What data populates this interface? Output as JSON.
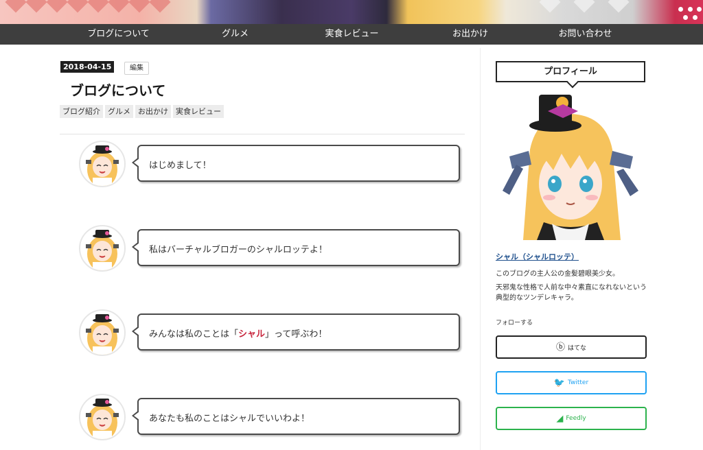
{
  "nav": {
    "items": [
      "ブログについて",
      "グルメ",
      "実食レビュー",
      "お出かけ",
      "お問い合わせ"
    ]
  },
  "post": {
    "date": "2018-04-15",
    "edit_label": "編集",
    "title": "ブログについて",
    "categories": [
      "ブログ紹介",
      "グルメ",
      "お出かけ",
      "実食レビュー"
    ]
  },
  "messages": [
    {
      "text": "はじめまして！"
    },
    {
      "text": "私はバーチャルブロガーのシャルロッテよ！"
    },
    {
      "pre": "みんなは私のことは「",
      "highlight": "シャル",
      "post": "」って呼ぶわ！"
    },
    {
      "text": "あなたも私のことはシャルでいいわよ！"
    }
  ],
  "sidebar": {
    "profile_title": "プロフィール",
    "name": "シャル（シャルロッテ）",
    "desc1": "このブログの主人公の金髪碧眼美少女。",
    "desc2": "天邪鬼な性格で人前な中々素直になれないという典型的なツンデレキャラ。",
    "follow_label": "フォローする",
    "follow_buttons": [
      {
        "label": "はてな",
        "icon": "hatena-icon",
        "color": "#222222"
      },
      {
        "label": "Twitter",
        "icon": "twitter-icon",
        "color": "#1da1f2"
      },
      {
        "label": "Feedly",
        "icon": "feedly-icon",
        "color": "#2bb24c"
      }
    ]
  },
  "colors": {
    "nav_bg": "#3e3e3e",
    "accent_red": "#c8263d",
    "link_blue": "#1e4f8c"
  }
}
